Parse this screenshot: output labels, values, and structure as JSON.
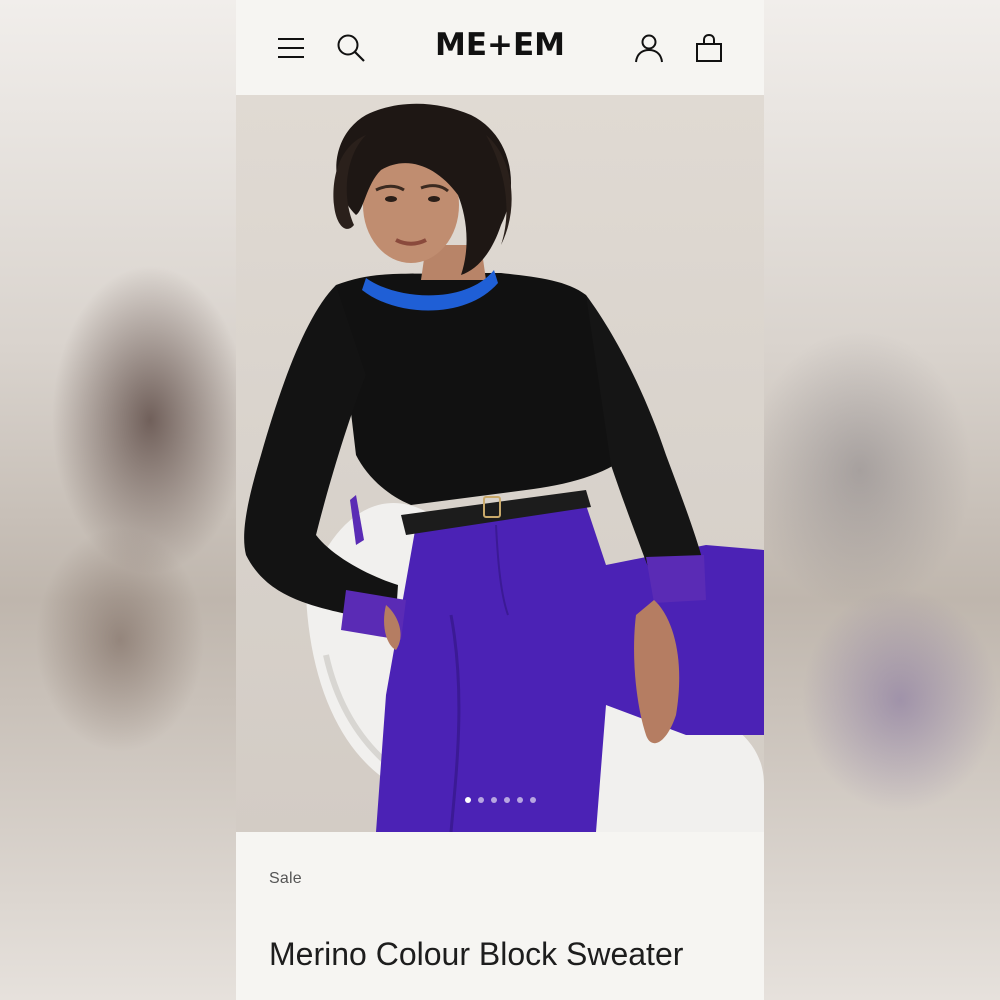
{
  "header": {
    "logo": "ME+EM",
    "menu_icon": "hamburger-menu-icon",
    "search_icon": "search-icon",
    "account_icon": "user-icon",
    "bag_icon": "shopping-bag-icon"
  },
  "gallery": {
    "total_images": 6,
    "active_index": 0
  },
  "product": {
    "badge": "Sale",
    "name": "Merino Colour Block Sweater"
  },
  "colors": {
    "page_bg": "#f6f5f2",
    "sweater": "#111111",
    "collar": "#1f5fd6",
    "trousers": "#4b22b5"
  }
}
